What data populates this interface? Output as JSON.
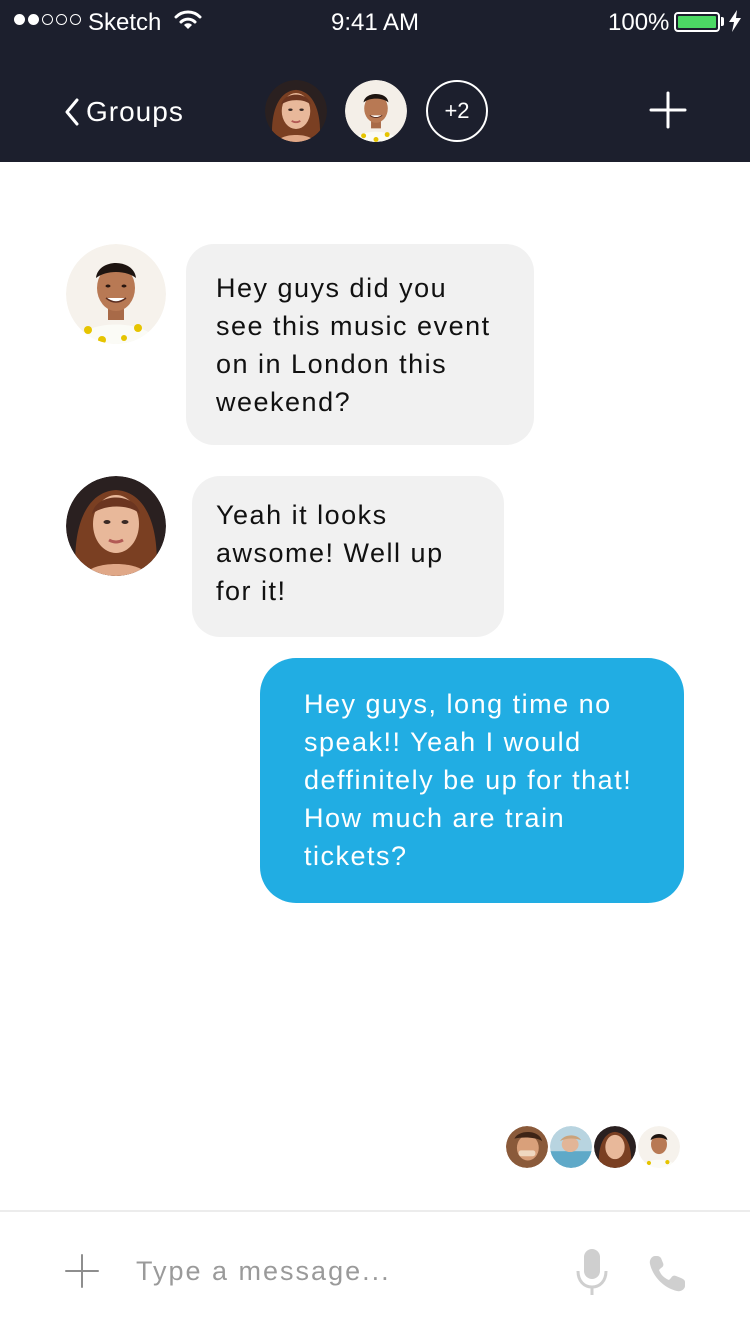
{
  "status_bar": {
    "carrier": "Sketch",
    "time": "9:41 AM",
    "battery": "100%",
    "signal_bars_filled": 2,
    "signal_bars_total": 5
  },
  "nav": {
    "back_label": "Groups",
    "more_members": "+2"
  },
  "messages": [
    {
      "sender": "incoming",
      "text": "Hey guys did you see this music event on in London this weekend?"
    },
    {
      "sender": "incoming",
      "text": "Yeah it looks awsome! Well up for it!"
    },
    {
      "sender": "outgoing",
      "text": "Hey guys, long time no speak!! Yeah I would deffinitely be up for that! How much are train tickets?"
    }
  ],
  "composer": {
    "placeholder": "Type a message..."
  },
  "colors": {
    "header_bg": "#1c1f2d",
    "outgoing_bubble": "#21ade3",
    "incoming_bubble": "#f1f1f1",
    "battery_fill": "#4cd964"
  },
  "icons": [
    "chevron-left-icon",
    "plus-icon",
    "wifi-icon",
    "battery-icon",
    "bolt-icon",
    "microphone-icon",
    "phone-icon"
  ]
}
